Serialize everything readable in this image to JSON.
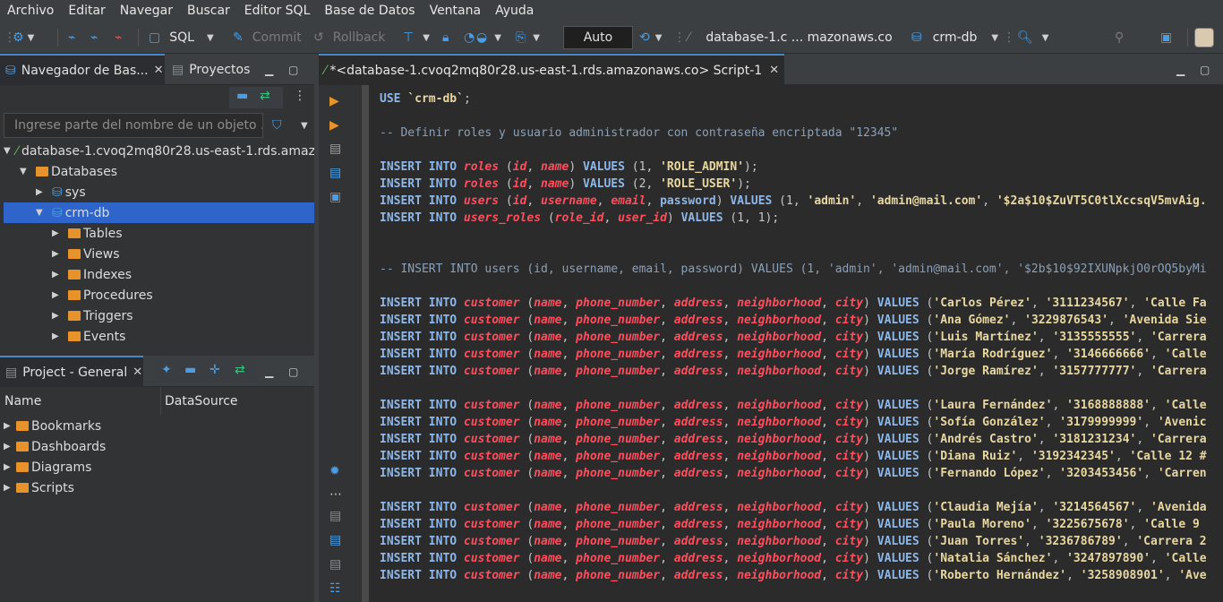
{
  "menu": [
    "Archivo",
    "Editar",
    "Navegar",
    "Buscar",
    "Editor SQL",
    "Base de Datos",
    "Ventana",
    "Ayuda"
  ],
  "toolbar": {
    "sql_label": "SQL",
    "commit_label": "Commit",
    "rollback_label": "Rollback",
    "auto_label": "Auto",
    "connection_label": "database-1.c ... mazonaws.co",
    "schema_label": "crm-db"
  },
  "navigator": {
    "tab_label": "Navegador de Bas...",
    "projects_tab_label": "Proyectos",
    "filter_placeholder": "Ingrese parte del nombre de un objeto ...",
    "connection": "database-1.cvoq2mq80r28.us-east-1.rds.amazo",
    "databases_label": "Databases",
    "schemas": [
      "sys",
      "crm-db"
    ],
    "folders": [
      "Tables",
      "Views",
      "Indexes",
      "Procedures",
      "Triggers",
      "Events"
    ]
  },
  "project": {
    "tab_label": "Project - General",
    "col_name": "Name",
    "col_datasource": "DataSource",
    "items": [
      "Bookmarks",
      "Dashboards",
      "Diagrams",
      "Scripts"
    ]
  },
  "editor": {
    "tab_label": "*<database-1.cvoq2mq80r28.us-east-1.rds.amazonaws.co> Script-1",
    "use_stmt": "`crm-db`",
    "comment1": "-- Definir roles y usuario administrador con contraseña encriptada \"12345\"",
    "comment2": "-- INSERT INTO users (id, username, email, password) VALUES (1, 'admin', 'admin@mail.com', '$2b$10$92IXUNpkjO0rOQ5byMi",
    "roles": [
      {
        "id": "1",
        "name": "'ROLE_ADMIN'"
      },
      {
        "id": "2",
        "name": "'ROLE_USER'"
      }
    ],
    "admin_user": {
      "id": "1",
      "username": "'admin'",
      "email": "'admin@mail.com'",
      "password": "'$2a$10$ZuVT5C0tlXccsqV5mvAig."
    },
    "user_role": {
      "role_id": "1",
      "user_id": "1"
    },
    "customers": [
      {
        "name": "'Carlos Pérez'",
        "phone": "'3111234567'",
        "rest": "'Calle Fa"
      },
      {
        "name": "'Ana Gómez'",
        "phone": "'3229876543'",
        "rest": "'Avenida Sie"
      },
      {
        "name": "'Luis Martínez'",
        "phone": "'3135555555'",
        "rest": "'Carrera"
      },
      {
        "name": "'María Rodríguez'",
        "phone": "'3146666666'",
        "rest": "'Calle"
      },
      {
        "name": "'Jorge Ramírez'",
        "phone": "'3157777777'",
        "rest": "'Carrera"
      },
      {
        "name": "'Laura Fernández'",
        "phone": "'3168888888'",
        "rest": "'Calle"
      },
      {
        "name": "'Sofía González'",
        "phone": "'3179999999'",
        "rest": "'Avenic"
      },
      {
        "name": "'Andrés Castro'",
        "phone": "'3181231234'",
        "rest": "'Carrera"
      },
      {
        "name": "'Diana Ruiz'",
        "phone": "'3192342345'",
        "rest": "'Calle 12 #"
      },
      {
        "name": "'Fernando López'",
        "phone": "'3203453456'",
        "rest": "'Carren"
      },
      {
        "name": "'Claudia Mejía'",
        "phone": "'3214564567'",
        "rest": "'Avenida"
      },
      {
        "name": "'Paula Moreno'",
        "phone": "'3225675678'",
        "rest": "'Calle 9"
      },
      {
        "name": "'Juan Torres'",
        "phone": "'3236786789'",
        "rest": "'Carrera 2"
      },
      {
        "name": "'Natalia Sánchez'",
        "phone": "'3247897890'",
        "rest": "'Calle"
      },
      {
        "name": "'Roberto Hernández'",
        "phone": "'3258908901'",
        "rest": "'Ave"
      }
    ]
  }
}
